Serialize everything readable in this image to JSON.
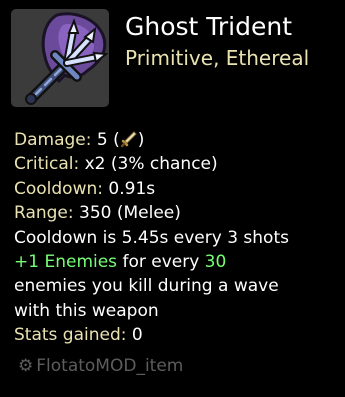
{
  "item": {
    "name": "Ghost Trident",
    "tags": "Primitive, Ethereal",
    "icon": "ghost-trident-icon"
  },
  "stats": {
    "damage_label": "Damage:",
    "damage_value": "5",
    "damage_open": " (",
    "damage_close": ")",
    "damage_scaling_icon": "melee-damage-icon",
    "critical_label": "Critical:",
    "critical_value": "x2 (3% chance)",
    "cooldown_label": "Cooldown:",
    "cooldown_value": "0.91s",
    "range_label": "Range:",
    "range_value": "350 (Melee)",
    "cooldown_effect": "Cooldown is 5.45s every 3 shots",
    "enemies_bonus": "+1 Enemies",
    "enemies_mid": "for every",
    "enemies_count": "30",
    "enemies_desc_1": "enemies you kill during a wave",
    "enemies_desc_2": "with this weapon",
    "gained_label": "Stats gained:",
    "gained_value": "0"
  },
  "source": {
    "icon": "gear-icon",
    "glyph": "⚙",
    "label": "FlotatoMOD_item"
  },
  "colors": {
    "background": "#000000",
    "key": "#eae2b0",
    "positive": "#76ff76",
    "muted": "#5d5d5d",
    "icon_frame": "#3b3b3b"
  }
}
